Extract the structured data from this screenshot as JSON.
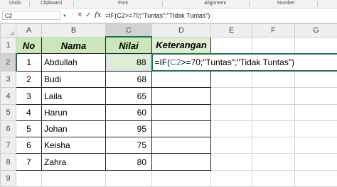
{
  "ribbon": {
    "groups": [
      "Undo",
      "Clipboard",
      "Font",
      "Alignment",
      "Number"
    ]
  },
  "formula_bar": {
    "name_box": "C2",
    "cancel_icon": "✕",
    "enter_icon": "✓",
    "fx_icon": "fx",
    "formula": "=IF(C2>=70;\"Tuntas\";\"Tidak Tuntas\")"
  },
  "sheet": {
    "columns": [
      "A",
      "B",
      "C",
      "D",
      "E",
      "F",
      "G"
    ],
    "rows": [
      "1",
      "2",
      "3",
      "4",
      "5",
      "6",
      "7",
      "8",
      "9"
    ],
    "header_row": {
      "no": "No",
      "nama": "Nama",
      "nilai": "Nilai",
      "keterangan": "Keterangan"
    },
    "data": [
      {
        "no": "1",
        "nama": "Abdullah",
        "nilai": "88"
      },
      {
        "no": "2",
        "nama": "Budi",
        "nilai": "68"
      },
      {
        "no": "3",
        "nama": "Laila",
        "nilai": "65"
      },
      {
        "no": "4",
        "nama": "Harun",
        "nilai": "60"
      },
      {
        "no": "5",
        "nama": "Johan",
        "nilai": "95"
      },
      {
        "no": "6",
        "nama": "Keisha",
        "nilai": "75"
      },
      {
        "no": "7",
        "nama": "Zahra",
        "nilai": "80"
      }
    ],
    "editing_cell": {
      "prefix": "=IF(",
      "ref": "C2",
      "suffix": ">=70;\"Tuntas\";\"Tidak Tuntas\")"
    }
  },
  "colors": {
    "header_fill_dark": "#c9e7b8",
    "header_fill_light": "#ddeed2",
    "excel_green": "#217346",
    "reference_blue": "#3b73c8"
  }
}
